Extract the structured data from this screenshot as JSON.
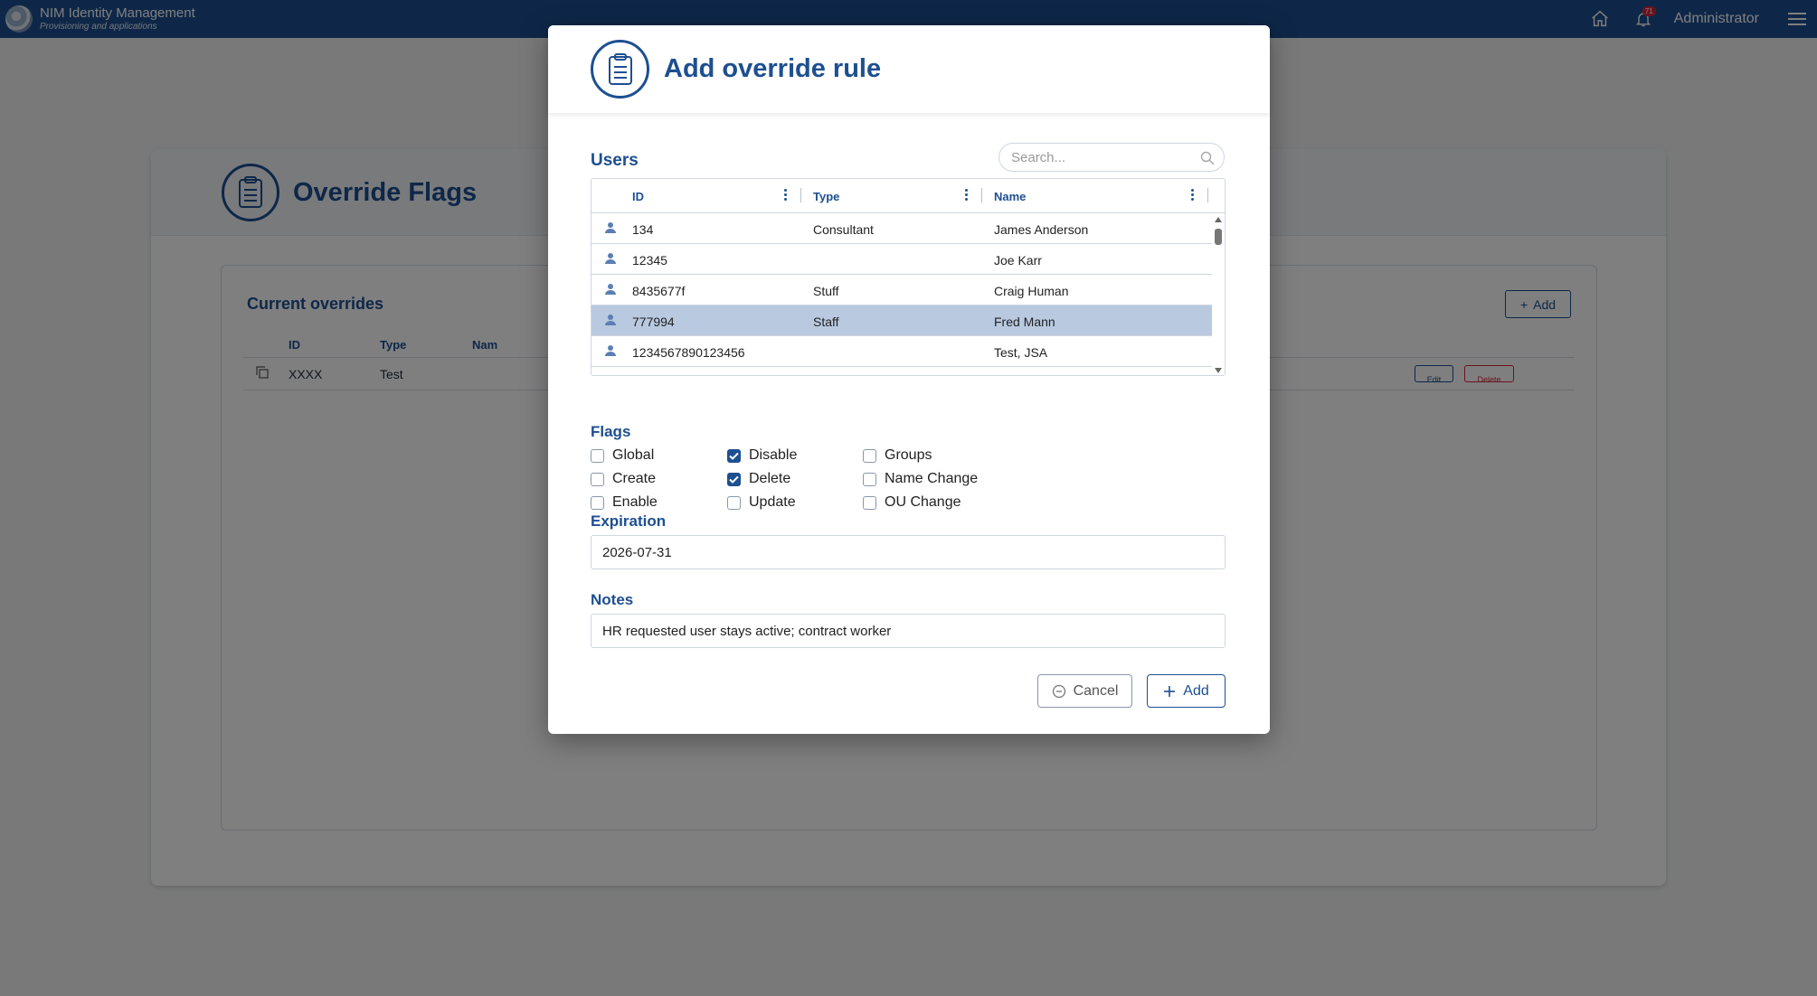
{
  "app": {
    "title": "NIM Identity Management",
    "subtitle": "Provisioning and applications",
    "notification_count": "71",
    "user_name": "Administrator"
  },
  "page": {
    "title": "Override Flags",
    "section_title": "Current overrides",
    "add_label": "Add",
    "columns": [
      "ID",
      "Type",
      "Nam"
    ],
    "rows": [
      {
        "id": "XXXX",
        "type": "Test"
      }
    ],
    "edit_label": "Edit",
    "delete_label": "Delete"
  },
  "modal": {
    "title": "Add override rule",
    "users_label": "Users",
    "search_placeholder": "Search...",
    "columns": {
      "id": "ID",
      "type": "Type",
      "name": "Name"
    },
    "users": [
      {
        "id": "134",
        "type": "Consultant",
        "name": "James Anderson",
        "selected": false
      },
      {
        "id": "12345",
        "type": "",
        "name": "Joe Karr",
        "selected": false
      },
      {
        "id": "8435677f",
        "type": "Stuff",
        "name": "Craig Human",
        "selected": false
      },
      {
        "id": "777994",
        "type": "Staff",
        "name": "Fred Mann",
        "selected": true
      },
      {
        "id": "1234567890123456",
        "type": "",
        "name": "Test, JSA",
        "selected": false
      }
    ],
    "flags_label": "Flags",
    "flags": [
      {
        "label": "Global",
        "checked": false
      },
      {
        "label": "Create",
        "checked": false
      },
      {
        "label": "Enable",
        "checked": false
      },
      {
        "label": "Disable",
        "checked": true
      },
      {
        "label": "Delete",
        "checked": true
      },
      {
        "label": "Update",
        "checked": false
      },
      {
        "label": "Groups",
        "checked": false
      },
      {
        "label": "Name Change",
        "checked": false
      },
      {
        "label": "OU Change",
        "checked": false
      }
    ],
    "expiration_label": "Expiration",
    "expiration_value": "2026-07-31",
    "notes_label": "Notes",
    "notes_value": "HR requested user stays active; contract worker",
    "cancel_label": "Cancel",
    "add_label": "Add"
  },
  "colors": {
    "primary": "#1d4f91",
    "selected_row": "#b8c9e0",
    "danger": "#d7263d"
  }
}
